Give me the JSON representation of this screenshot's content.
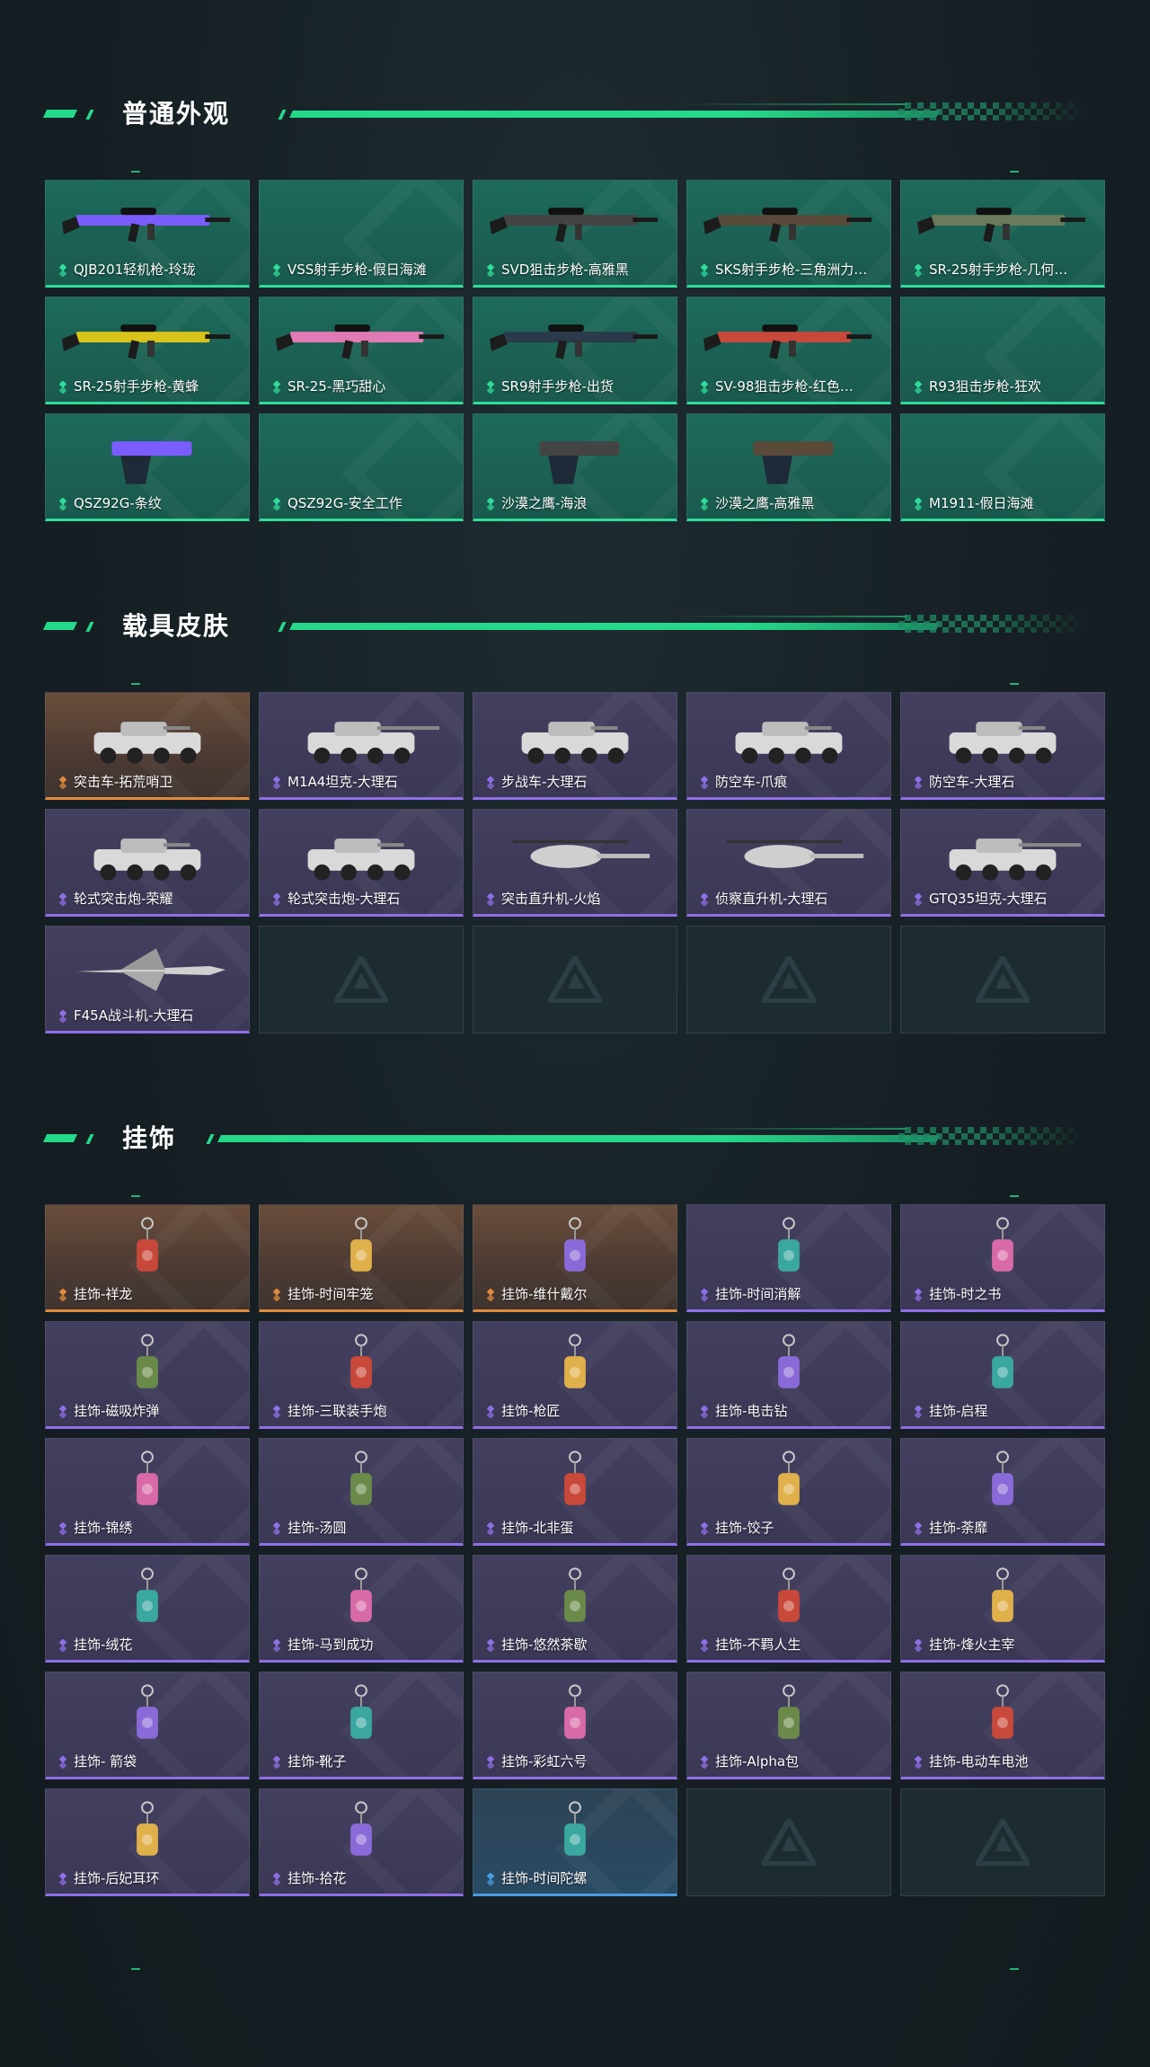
{
  "colors": {
    "accent": "#25d98a",
    "rarity_green": "#2fdc99",
    "rarity_purple": "#8f6fe6",
    "rarity_orange": "#e08a3c",
    "rarity_blue": "#4a9ce0"
  },
  "sections": {
    "weapons": {
      "title": "普通外观",
      "items": [
        {
          "label": "QJB201轻机枪-玲珑",
          "rarity": "green",
          "icon": "light-machine-gun-icon"
        },
        {
          "label": "VSS射手步枪-假日海滩",
          "rarity": "green",
          "icon": "none"
        },
        {
          "label": "SVD狙击步枪-高雅黑",
          "rarity": "green",
          "icon": "sniper-rifle-icon"
        },
        {
          "label": "SKS射手步枪-三角洲力…",
          "rarity": "green",
          "icon": "marksman-rifle-icon"
        },
        {
          "label": "SR-25射手步枪-几何…",
          "rarity": "green",
          "icon": "marksman-rifle-icon"
        },
        {
          "label": "SR-25射手步枪-黄蜂",
          "rarity": "green",
          "icon": "marksman-rifle-icon"
        },
        {
          "label": "SR-25-黑巧甜心",
          "rarity": "green",
          "icon": "marksman-rifle-icon"
        },
        {
          "label": "SR9射手步枪-出货",
          "rarity": "green",
          "icon": "marksman-rifle-icon"
        },
        {
          "label": "SV-98狙击步枪-红色…",
          "rarity": "green",
          "icon": "sniper-rifle-icon"
        },
        {
          "label": "R93狙击步枪-狂欢",
          "rarity": "green",
          "icon": "none"
        },
        {
          "label": "QSZ92G-条纹",
          "rarity": "green",
          "icon": "pistol-icon"
        },
        {
          "label": "QSZ92G-安全工作",
          "rarity": "green",
          "icon": "none"
        },
        {
          "label": "沙漠之鹰-海浪",
          "rarity": "green",
          "icon": "pistol-icon"
        },
        {
          "label": "沙漠之鹰-高雅黑",
          "rarity": "green",
          "icon": "pistol-icon"
        },
        {
          "label": "M1911-假日海滩",
          "rarity": "green",
          "icon": "none"
        }
      ]
    },
    "vehicles": {
      "title": "载具皮肤",
      "items": [
        {
          "label": "突击车-拓荒哨卫",
          "rarity": "orange",
          "icon": "assault-vehicle-icon"
        },
        {
          "label": "M1A4坦克-大理石",
          "rarity": "purple",
          "icon": "tank-icon"
        },
        {
          "label": "步战车-大理石",
          "rarity": "purple",
          "icon": "ifv-icon"
        },
        {
          "label": "防空车-爪痕",
          "rarity": "purple",
          "icon": "ifv-icon"
        },
        {
          "label": "防空车-大理石",
          "rarity": "purple",
          "icon": "ifv-icon"
        },
        {
          "label": "轮式突击炮-荣耀",
          "rarity": "purple",
          "icon": "assault-vehicle-icon"
        },
        {
          "label": "轮式突击炮-大理石",
          "rarity": "purple",
          "icon": "assault-vehicle-icon"
        },
        {
          "label": "突击直升机-火焰",
          "rarity": "purple",
          "icon": "helicopter-icon"
        },
        {
          "label": "侦察直升机-大理石",
          "rarity": "purple",
          "icon": "helicopter-icon"
        },
        {
          "label": "GTQ35坦克-大理石",
          "rarity": "purple",
          "icon": "tank-icon"
        },
        {
          "label": "F45A战斗机-大理石",
          "rarity": "purple",
          "icon": "fighter-jet-icon"
        },
        {
          "label": "",
          "rarity": "empty"
        },
        {
          "label": "",
          "rarity": "empty"
        },
        {
          "label": "",
          "rarity": "empty"
        },
        {
          "label": "",
          "rarity": "empty"
        }
      ]
    },
    "charms": {
      "title": "挂饰",
      "items": [
        {
          "label": "挂饰-祥龙",
          "rarity": "orange",
          "icon": "charm-icon"
        },
        {
          "label": "挂饰-时间牢笼",
          "rarity": "orange",
          "icon": "charm-icon"
        },
        {
          "label": "挂饰-维什戴尔",
          "rarity": "orange",
          "icon": "charm-icon"
        },
        {
          "label": "挂饰-时间消解",
          "rarity": "purple",
          "icon": "charm-icon"
        },
        {
          "label": "挂饰-时之书",
          "rarity": "purple",
          "icon": "charm-icon"
        },
        {
          "label": "挂饰-磁吸炸弹",
          "rarity": "purple",
          "icon": "charm-icon"
        },
        {
          "label": "挂饰-三联装手炮",
          "rarity": "purple",
          "icon": "charm-icon"
        },
        {
          "label": "挂饰-枪匠",
          "rarity": "purple",
          "icon": "charm-icon"
        },
        {
          "label": "挂饰-电击钻",
          "rarity": "purple",
          "icon": "charm-icon"
        },
        {
          "label": "挂饰-启程",
          "rarity": "purple",
          "icon": "charm-icon"
        },
        {
          "label": "挂饰-锦绣",
          "rarity": "purple",
          "icon": "charm-icon"
        },
        {
          "label": "挂饰-汤圆",
          "rarity": "purple",
          "icon": "charm-icon"
        },
        {
          "label": "挂饰-北非蛋",
          "rarity": "purple",
          "icon": "charm-icon"
        },
        {
          "label": "挂饰-饺子",
          "rarity": "purple",
          "icon": "charm-icon"
        },
        {
          "label": "挂饰-荼靡",
          "rarity": "purple",
          "icon": "charm-icon"
        },
        {
          "label": "挂饰-绒花",
          "rarity": "purple",
          "icon": "charm-icon"
        },
        {
          "label": "挂饰-马到成功",
          "rarity": "purple",
          "icon": "charm-icon"
        },
        {
          "label": "挂饰-悠然茶歇",
          "rarity": "purple",
          "icon": "charm-icon"
        },
        {
          "label": "挂饰-不羁人生",
          "rarity": "purple",
          "icon": "charm-icon"
        },
        {
          "label": "挂饰-烽火主宰",
          "rarity": "purple",
          "icon": "charm-icon"
        },
        {
          "label": "挂饰- 箭袋",
          "rarity": "purple",
          "icon": "charm-icon"
        },
        {
          "label": "挂饰-靴子",
          "rarity": "purple",
          "icon": "charm-icon"
        },
        {
          "label": "挂饰-彩虹六号",
          "rarity": "purple",
          "icon": "charm-icon"
        },
        {
          "label": "挂饰-Alpha包",
          "rarity": "purple",
          "icon": "charm-icon"
        },
        {
          "label": "挂饰-电动车电池",
          "rarity": "purple",
          "icon": "charm-icon"
        },
        {
          "label": "挂饰-后妃耳环",
          "rarity": "purple",
          "icon": "charm-icon"
        },
        {
          "label": "挂饰-拾花",
          "rarity": "purple",
          "icon": "charm-icon"
        },
        {
          "label": "挂饰-时间陀螺",
          "rarity": "blue",
          "icon": "charm-icon"
        },
        {
          "label": "",
          "rarity": "empty"
        },
        {
          "label": "",
          "rarity": "empty"
        }
      ]
    }
  }
}
